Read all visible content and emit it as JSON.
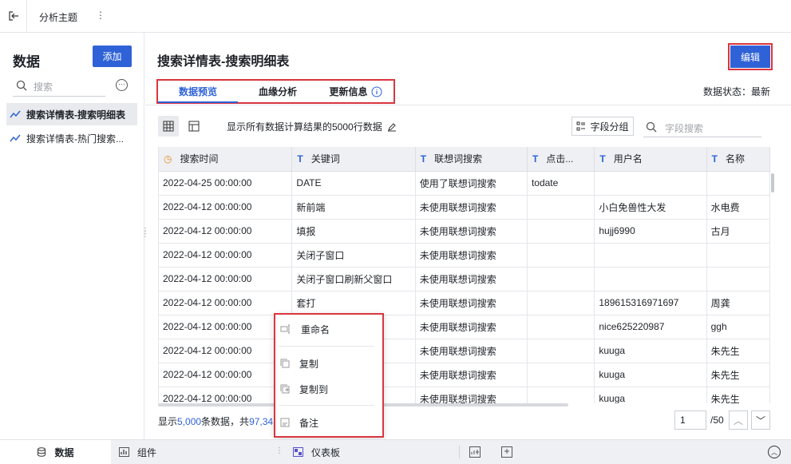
{
  "topbar": {
    "title": "分析主题"
  },
  "left": {
    "heading": "数据",
    "add_label": "添加",
    "search_placeholder": "搜索",
    "items": [
      {
        "label": "搜索详情表-搜索明细表"
      },
      {
        "label": "搜索详情表-热门搜索..."
      }
    ]
  },
  "main": {
    "title": "搜索详情表-搜索明细表",
    "edit_label": "编辑",
    "tabs": [
      {
        "label": "数据预览"
      },
      {
        "label": "血缘分析"
      },
      {
        "label": "更新信息"
      }
    ],
    "status": "数据状态：最新",
    "note": "显示所有数据计算结果的5000行数据",
    "group_label": "字段分组",
    "field_search_placeholder": "字段搜索"
  },
  "table": {
    "columns": [
      "搜索时间",
      "关键词",
      "联想词搜索",
      "点击...",
      "用户名",
      "名称"
    ],
    "rows": [
      [
        "2022-04-25 00:00:00",
        "DATE",
        "使用了联想词搜索",
        "todate",
        "",
        ""
      ],
      [
        "2022-04-12 00:00:00",
        "新前端",
        "未使用联想词搜索",
        "",
        "小白免兽性大发",
        "水电费"
      ],
      [
        "2022-04-12 00:00:00",
        "填报",
        "未使用联想词搜索",
        "",
        "hujj6990",
        "古月"
      ],
      [
        "2022-04-12 00:00:00",
        "关闭子窗口",
        "未使用联想词搜索",
        "",
        "",
        ""
      ],
      [
        "2022-04-12 00:00:00",
        "关闭子窗口刷新父窗口",
        "未使用联想词搜索",
        "",
        "",
        ""
      ],
      [
        "2022-04-12 00:00:00",
        "套打",
        "未使用联想词搜索",
        "",
        "189615316971697",
        "周龚"
      ],
      [
        "2022-04-12 00:00:00",
        "",
        "未使用联想词搜索",
        "",
        "nice625220987",
        "ggh"
      ],
      [
        "2022-04-12 00:00:00",
        "",
        "未使用联想词搜索",
        "",
        "kuuga",
        "朱先生"
      ],
      [
        "2022-04-12 00:00:00",
        "",
        "未使用联想词搜索",
        "",
        "kuuga",
        "朱先生"
      ],
      [
        "2022-04-12 00:00:00",
        "",
        "未使用联想词搜索",
        "",
        "kuuga",
        "朱先生"
      ]
    ]
  },
  "footer": {
    "prefix": "显示",
    "shown": "5,000",
    "middle": "条数据，共",
    "total": "97,34",
    "page": "1",
    "page_total": "/50"
  },
  "context_menu": {
    "rename": "重命名",
    "copy": "复制",
    "copy_to": "复制到",
    "remark": "备注"
  },
  "bottombar": {
    "data_label": "数据",
    "component_label": "组件",
    "dashboard_label": "仪表板"
  },
  "colors": {
    "accent": "#2f62d6",
    "highlight": "#d9363e"
  }
}
